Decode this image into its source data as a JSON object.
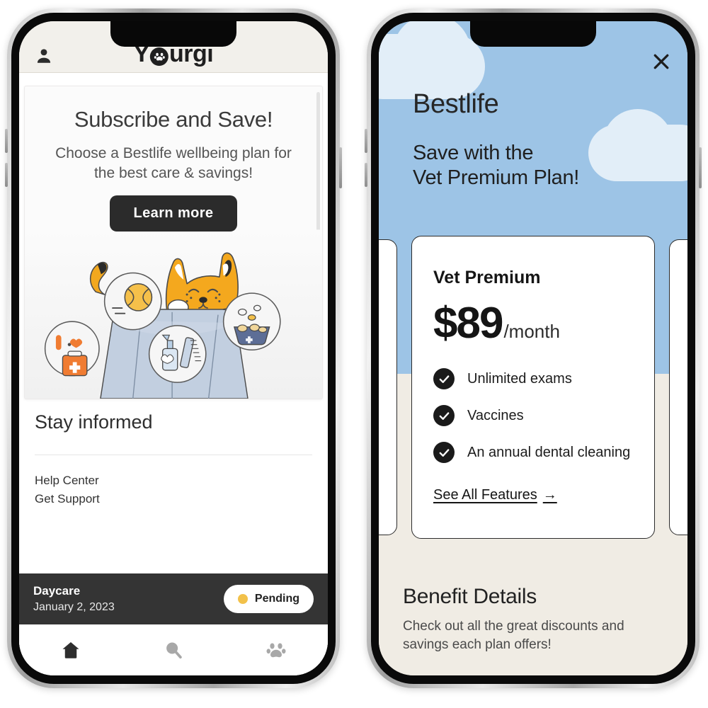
{
  "left_phone": {
    "header": {
      "brand": "Y",
      "brand_mid": "o",
      "brand_end": "urgi",
      "avatar_icon": "person-icon"
    },
    "promo": {
      "title": "Subscribe and Save!",
      "subtitle": "Choose a Bestlife wellbeing plan for the best care & savings!",
      "cta_label": "Learn more",
      "illustration": "cat-in-supply-bag-illustration"
    },
    "stay_informed": {
      "title": "Stay informed",
      "links": [
        "Help Center",
        "Get Support"
      ]
    },
    "appointment": {
      "name": "Daycare",
      "date": "January 2, 2023",
      "status": "Pending",
      "status_color": "#f2c14a"
    },
    "tabbar": [
      {
        "name": "home-tab",
        "icon": "home-icon",
        "active": true
      },
      {
        "name": "search-tab",
        "icon": "search-icon",
        "active": false
      },
      {
        "name": "pets-tab",
        "icon": "paw-icon",
        "active": false
      }
    ]
  },
  "right_phone": {
    "close_icon": "close-icon",
    "sky_color": "#9dc4e6",
    "title": "Bestlife",
    "subtitle": "Save with the\nVet Premium Plan!",
    "subtitle_line1": "Save with the",
    "subtitle_line2": "Vet Premium Plan!",
    "plan_card": {
      "name": "Vet Premium",
      "price": "$89",
      "period": "/month",
      "features": [
        "Unlimited exams",
        "Vaccines",
        "An annual dental cleaning"
      ],
      "see_all_label": "See All Features",
      "see_all_arrow": "→"
    },
    "benefits": {
      "title": "Benefit Details",
      "subtitle": "Check out all the great discounts and savings each plan offers!"
    }
  }
}
